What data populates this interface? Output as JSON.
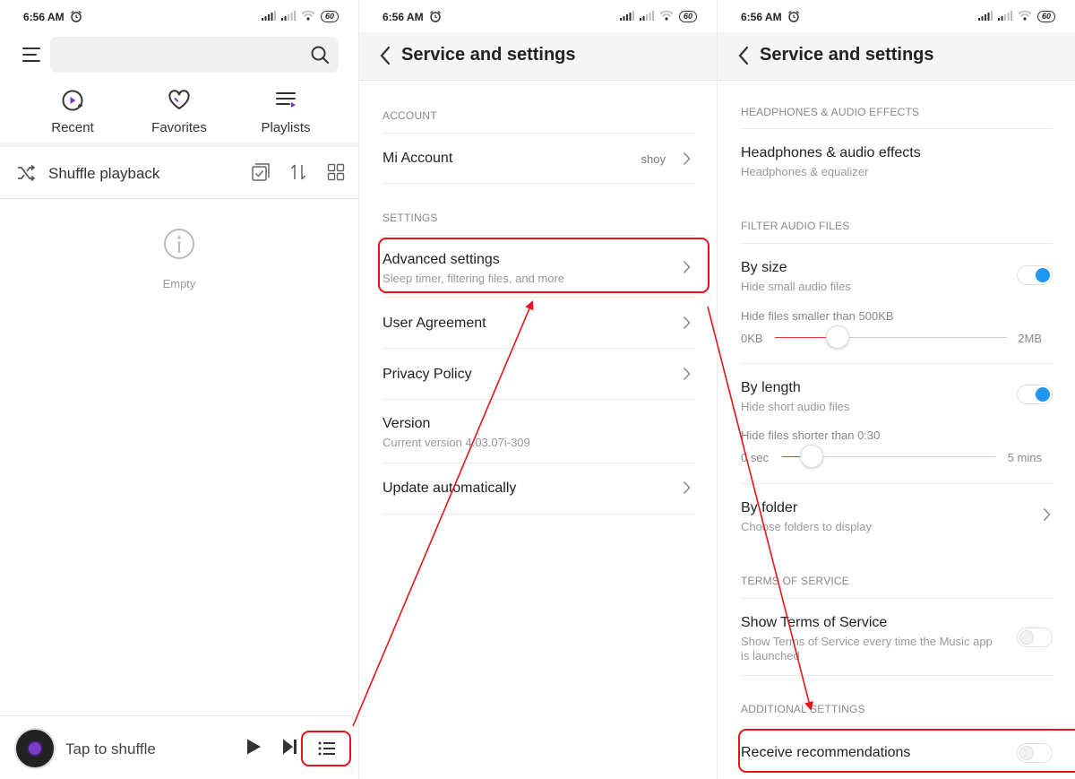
{
  "status_bar": {
    "time": "6:56 AM",
    "battery": "60"
  },
  "home": {
    "quick_links": [
      {
        "label": "Recent",
        "icon": "recent-icon"
      },
      {
        "label": "Favorites",
        "icon": "heart-icon"
      },
      {
        "label": "Playlists",
        "icon": "playlist-icon"
      }
    ],
    "shuffle_label": "Shuffle playback",
    "empty_label": "Empty",
    "player_label": "Tap to shuffle"
  },
  "service_settings": {
    "title": "Service and settings",
    "account_header": "ACCOUNT",
    "mi_account": {
      "title": "Mi Account",
      "value": "shoy"
    },
    "settings_header": "SETTINGS",
    "advanced": {
      "title": "Advanced settings",
      "subtitle": "Sleep timer, filtering files, and more"
    },
    "user_agreement": "User Agreement",
    "privacy_policy": "Privacy Policy",
    "version": {
      "title": "Version",
      "subtitle": "Current version 4.03.07i-309"
    },
    "update_auto": "Update automatically"
  },
  "advanced_settings": {
    "title": "Service and settings",
    "headphones_header": "HEADPHONES & AUDIO EFFECTS",
    "headphones": {
      "title": "Headphones & audio effects",
      "subtitle": "Headphones & equalizer"
    },
    "filter_header": "FILTER AUDIO FILES",
    "by_size": {
      "title": "By size",
      "subtitle": "Hide small audio files",
      "enabled": true,
      "slider_label": "Hide files smaller than 500KB",
      "min": "0KB",
      "max": "2MB",
      "value_fraction": 0.27
    },
    "by_length": {
      "title": "By length",
      "subtitle": "Hide short audio files",
      "enabled": true,
      "slider_label": "Hide files shorter than 0:30",
      "min": "0 sec",
      "max": "5 mins",
      "value_fraction": 0.14
    },
    "by_folder": {
      "title": "By folder",
      "subtitle": "Choose folders to display"
    },
    "terms_header": "TERMS OF SERVICE",
    "show_terms": {
      "title": "Show Terms of Service",
      "subtitle_line1": "Show Terms of Service every time the Music app",
      "subtitle_line2": "is launched",
      "enabled": false
    },
    "additional_header": "ADDITIONAL SETTINGS",
    "recommendations": {
      "title": "Receive recommendations",
      "enabled": false
    }
  },
  "colors": {
    "highlight": "#e8141b",
    "toggle_on": "#2196f3",
    "slider_fill": "#e23b3b",
    "accent_purple": "#7a3cc7"
  }
}
